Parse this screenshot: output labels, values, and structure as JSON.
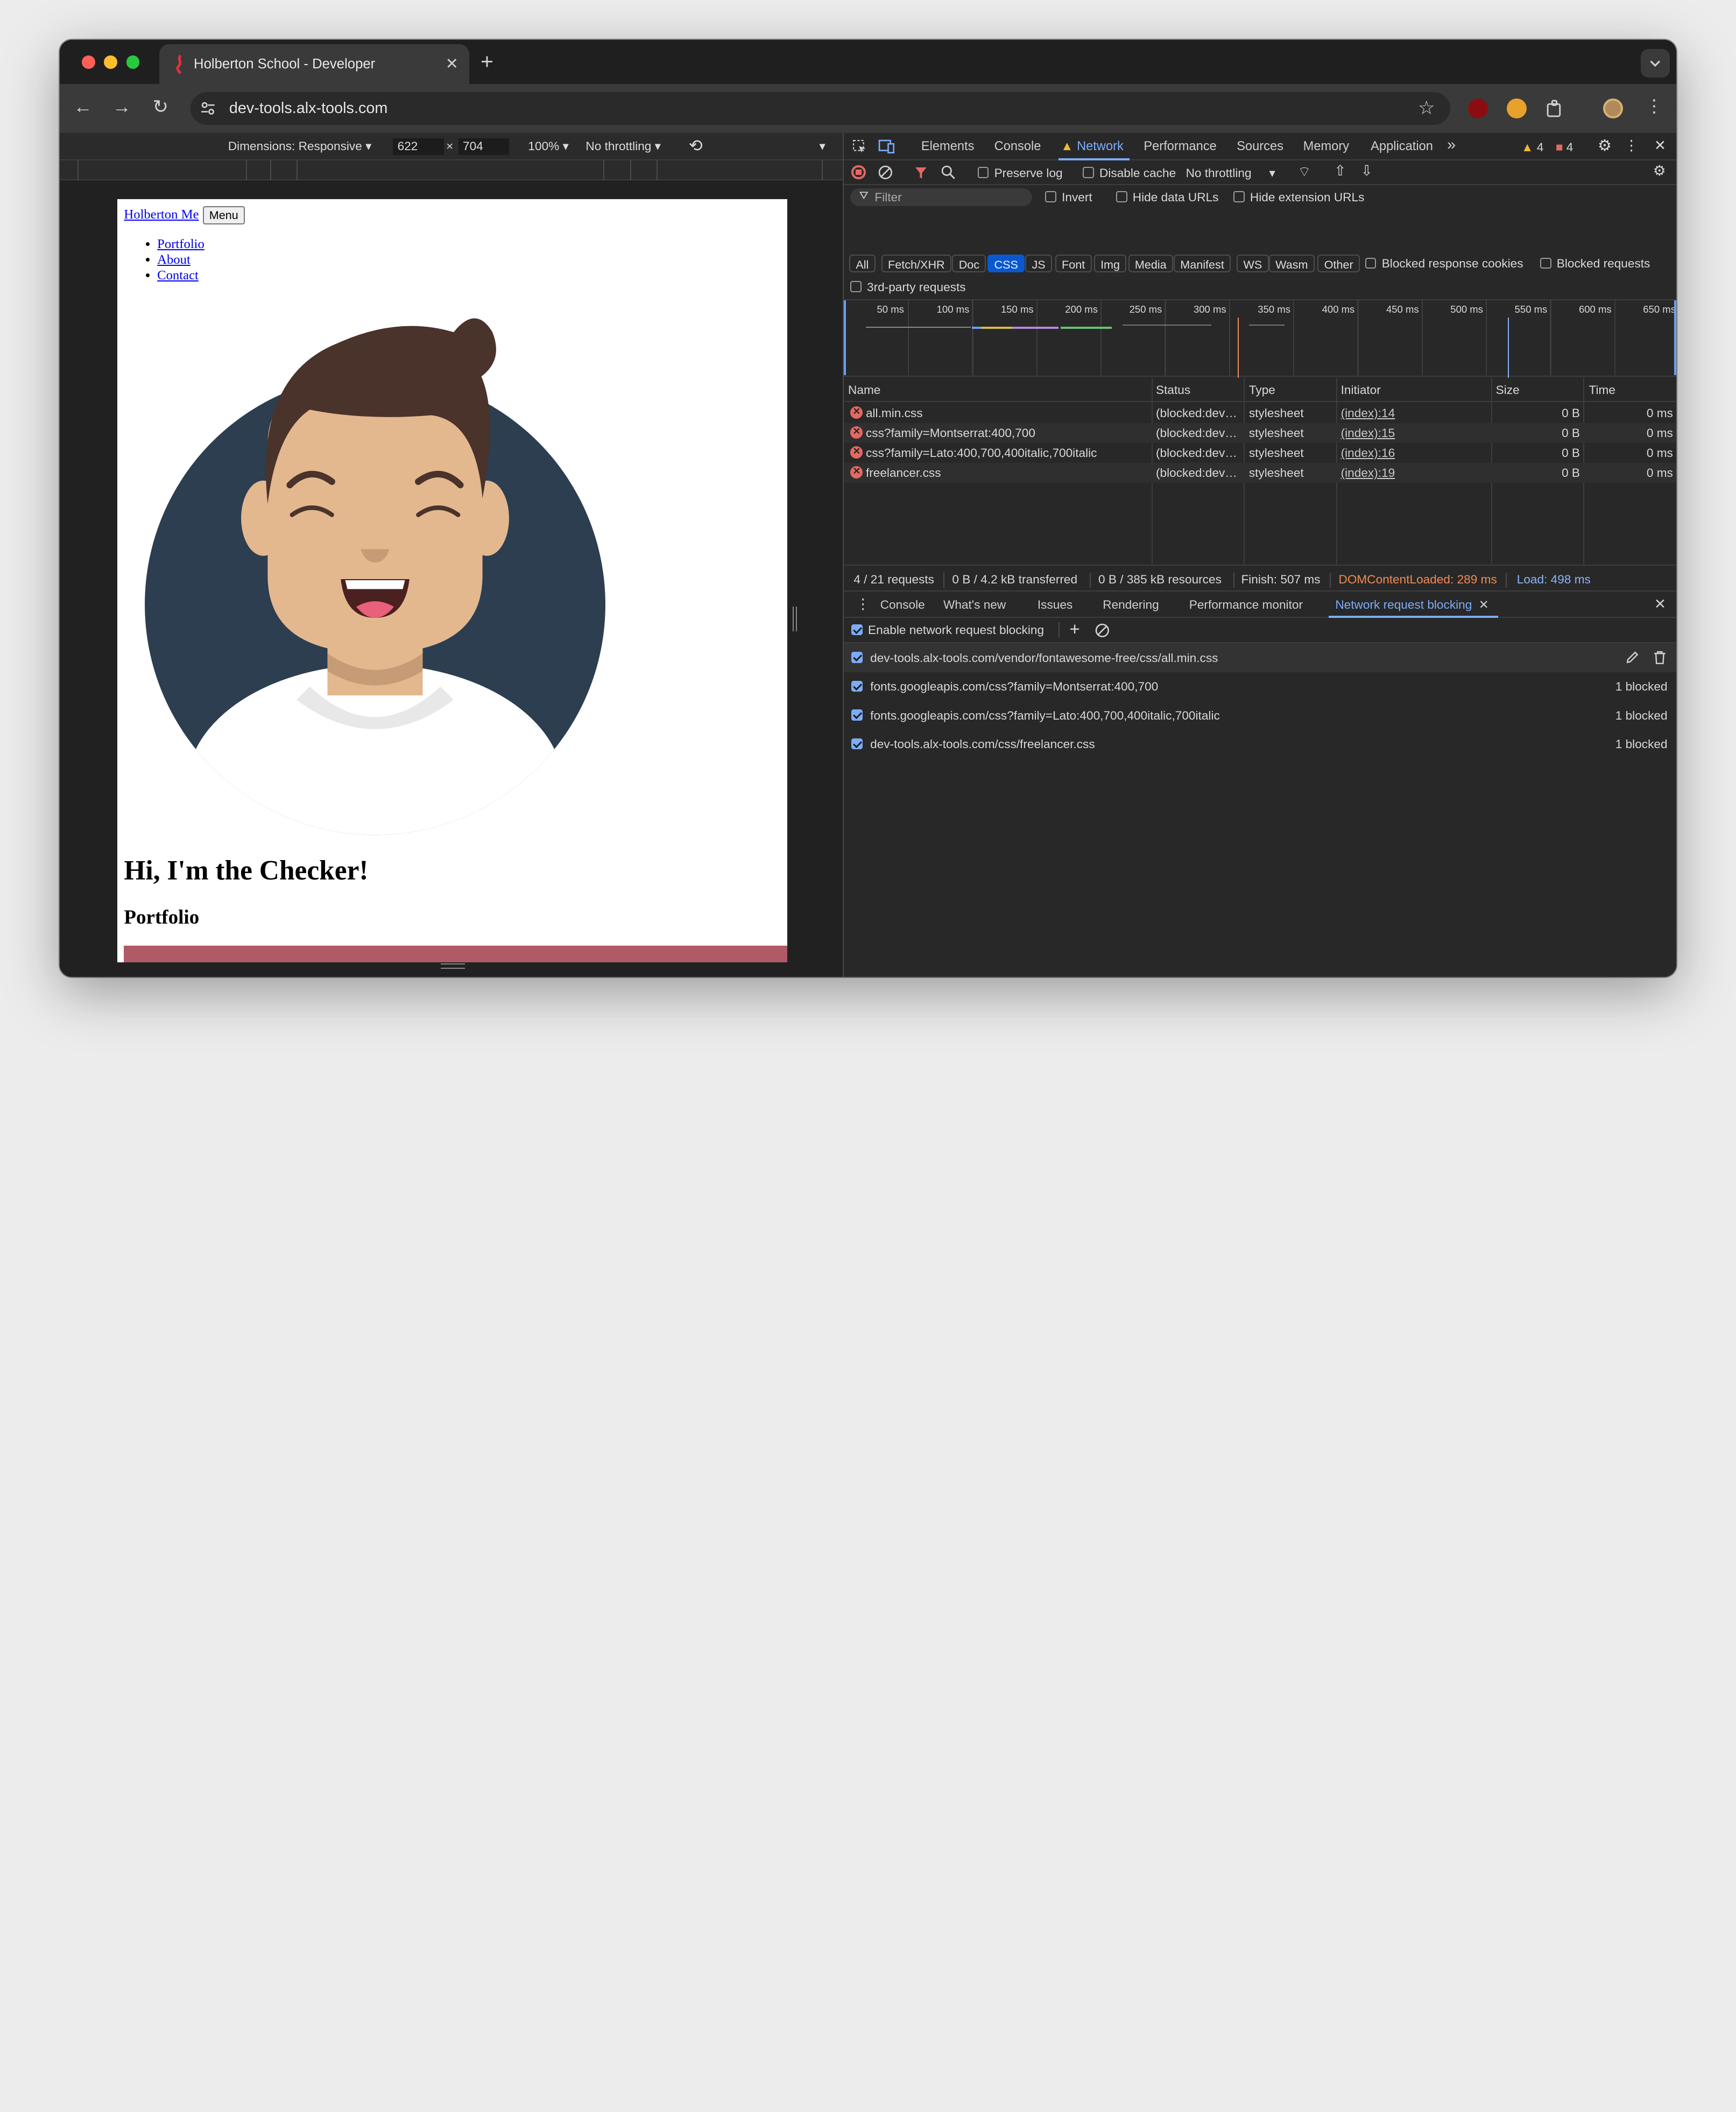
{
  "browser": {
    "tab_title": "Holberton School - Developer",
    "tab_close": "✕",
    "new_tab": "+",
    "url": "dev-tools.alx-tools.com"
  },
  "device_toolbar": {
    "dimensions_label": "Dimensions: Responsive",
    "width": "622",
    "times": "×",
    "height": "704",
    "zoom": "100%",
    "throttling": "No throttling"
  },
  "page": {
    "brand": "Holberton Me",
    "menu_button": "Menu",
    "nav": [
      "Portfolio",
      "About",
      "Contact"
    ],
    "heading": "Hi, I'm the Checker!",
    "subheading": "Portfolio"
  },
  "devtools": {
    "panels": [
      "Elements",
      "Console",
      "Network",
      "Performance",
      "Sources",
      "Memory",
      "Application"
    ],
    "active_panel": "Network",
    "more_panels": "»",
    "warnings": "4",
    "errors": "4",
    "network_toolbar": {
      "preserve_log": "Preserve log",
      "disable_cache": "Disable cache",
      "throttling": "No throttling"
    },
    "filter": {
      "placeholder": "Filter",
      "invert": "Invert",
      "hide_data_urls": "Hide data URLs",
      "hide_extension_urls": "Hide extension URLs",
      "types": [
        "All",
        "Fetch/XHR",
        "Doc",
        "CSS",
        "JS",
        "Font",
        "Img",
        "Media",
        "Manifest",
        "WS",
        "Wasm",
        "Other"
      ],
      "active_type": "CSS",
      "blocked_response_cookies": "Blocked response cookies",
      "blocked_requests": "Blocked requests",
      "third_party": "3rd-party requests"
    },
    "timeline_ticks": [
      "50 ms",
      "100 ms",
      "150 ms",
      "200 ms",
      "250 ms",
      "300 ms",
      "350 ms",
      "400 ms",
      "450 ms",
      "500 ms",
      "550 ms",
      "600 ms",
      "650 ms"
    ],
    "table": {
      "columns": [
        "Name",
        "Status",
        "Type",
        "Initiator",
        "Size",
        "Time"
      ],
      "rows": [
        {
          "name": "all.min.css",
          "status": "(blocked:dev…",
          "type": "stylesheet",
          "initiator": "(index):14",
          "size": "0 B",
          "time": "0 ms"
        },
        {
          "name": "css?family=Montserrat:400,700",
          "status": "(blocked:dev…",
          "type": "stylesheet",
          "initiator": "(index):15",
          "size": "0 B",
          "time": "0 ms"
        },
        {
          "name": "css?family=Lato:400,700,400italic,700italic",
          "status": "(blocked:dev…",
          "type": "stylesheet",
          "initiator": "(index):16",
          "size": "0 B",
          "time": "0 ms"
        },
        {
          "name": "freelancer.css",
          "status": "(blocked:dev…",
          "type": "stylesheet",
          "initiator": "(index):19",
          "size": "0 B",
          "time": "0 ms"
        }
      ]
    },
    "summary": {
      "requests": "4 / 21 requests",
      "transferred": "0 B / 4.2 kB transferred",
      "resources": "0 B / 385 kB resources",
      "finish": "Finish: 507 ms",
      "dom_content_loaded": "DOMContentLoaded: 289 ms",
      "load": "Load: 498 ms"
    },
    "drawer": {
      "tabs": [
        "Console",
        "What's new",
        "Issues",
        "Rendering",
        "Performance monitor",
        "Network request blocking"
      ],
      "active_tab": "Network request blocking",
      "enable_label": "Enable network request blocking",
      "patterns": [
        {
          "pattern": "dev-tools.alx-tools.com/vendor/fontawesome-free/css/all.min.css",
          "count": ""
        },
        {
          "pattern": "fonts.googleapis.com/css?family=Montserrat:400,700",
          "count": "1 blocked"
        },
        {
          "pattern": "fonts.googleapis.com/css?family=Lato:400,700,400italic,700italic",
          "count": "1 blocked"
        },
        {
          "pattern": "dev-tools.alx-tools.com/css/freelancer.css",
          "count": "1 blocked"
        }
      ]
    }
  },
  "colors": {
    "accent_blue": "#7cacf8",
    "error_red": "#e46962",
    "dcl_orange": "#f28b54",
    "load_blue": "#8ab4f8",
    "avatar_bg": "#2c3e50"
  }
}
